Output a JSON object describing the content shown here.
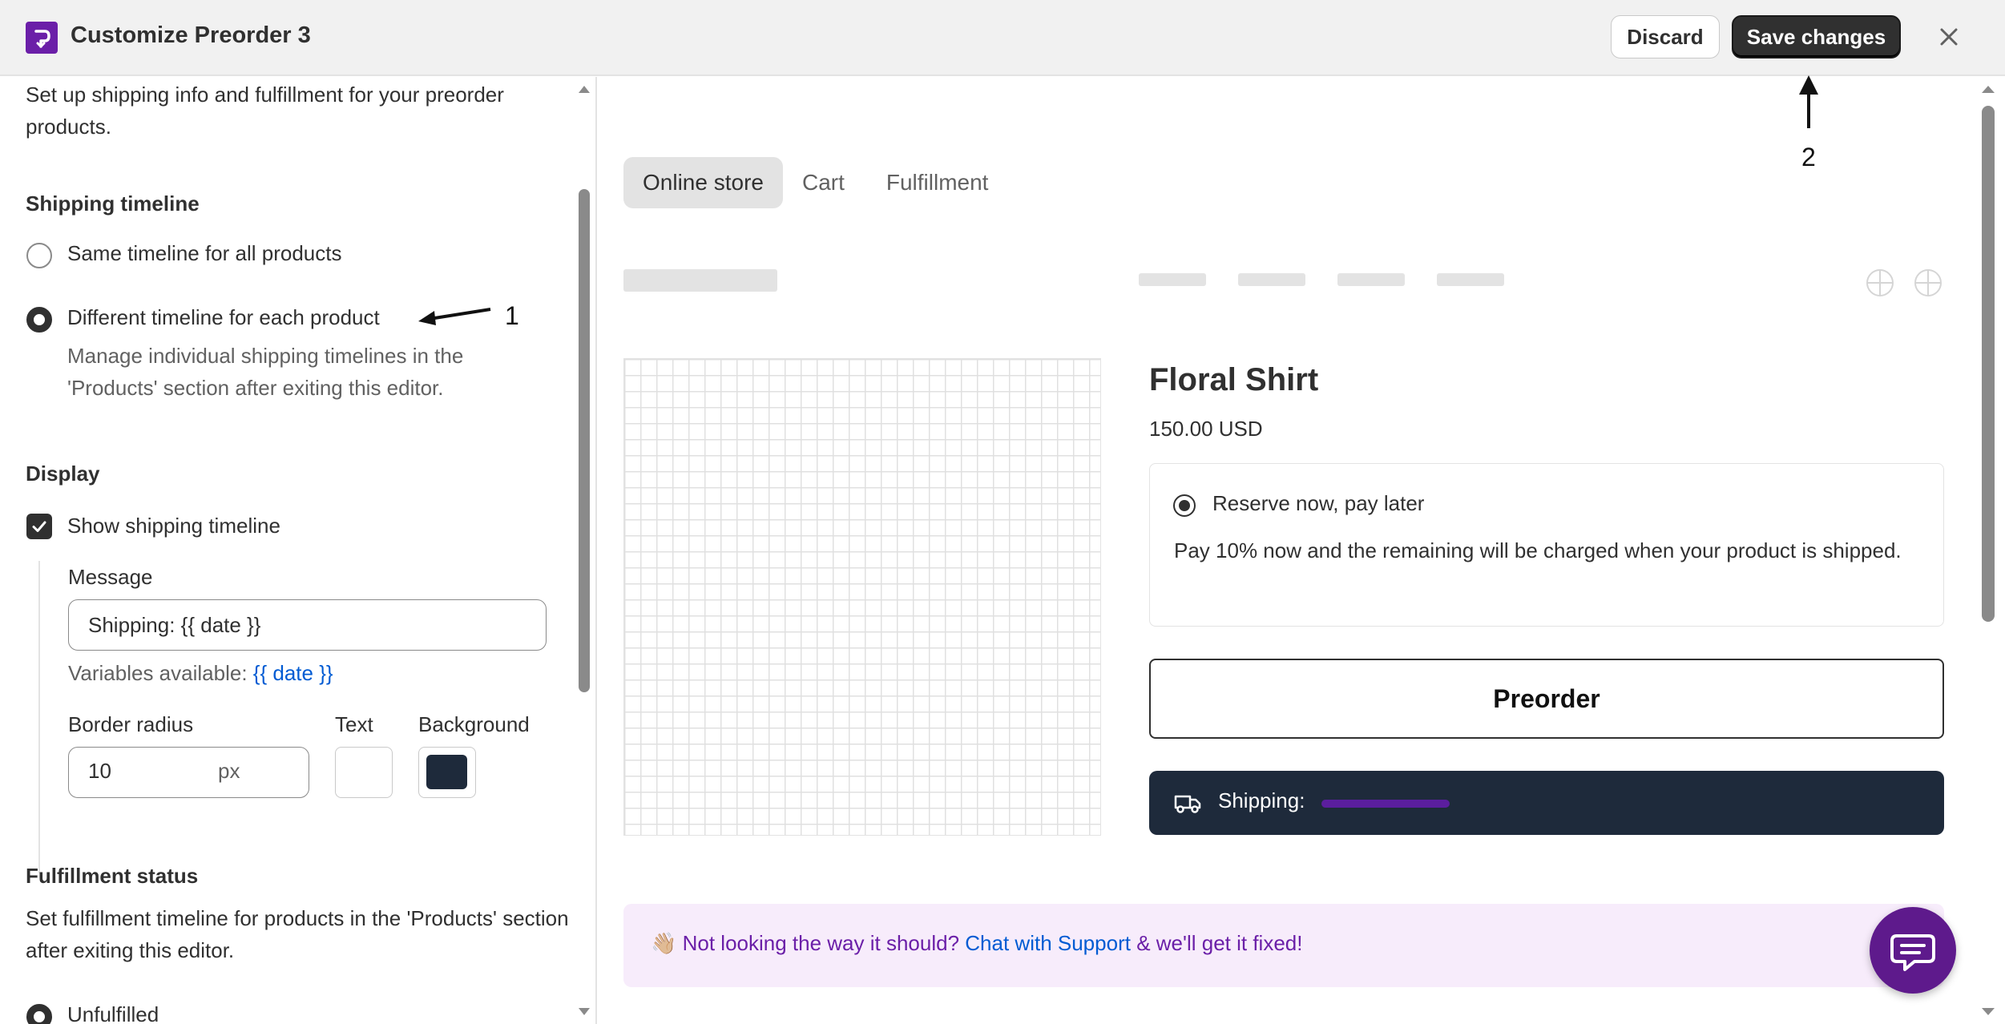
{
  "header": {
    "title": "Customize Preorder 3",
    "discard_label": "Discard",
    "save_label": "Save changes"
  },
  "left": {
    "intro": "Set up shipping info and fulfillment for your preorder products.",
    "shipping_timeline": {
      "heading": "Shipping timeline",
      "option_same": "Same timeline for all products",
      "option_different": "Different timeline for each product",
      "selected": "option_different",
      "help": "Manage individual shipping timelines in the 'Products' section after exiting this editor."
    },
    "display": {
      "heading": "Display",
      "show_label": "Show shipping timeline",
      "show_checked": true,
      "message_label": "Message",
      "message_value": "Shipping: {{ date }}",
      "variables_label": "Variables available:",
      "variables_value": "{{ date }}",
      "border_radius_label": "Border radius",
      "border_radius_value": "10",
      "border_radius_unit": "px",
      "text_label": "Text",
      "text_color": "#ffffff",
      "background_label": "Background",
      "background_color": "#1e2a3b"
    },
    "fulfillment": {
      "heading": "Fulfillment status",
      "help": "Set fulfillment timeline for products in the 'Products' section after exiting this editor.",
      "option_unfulfilled": "Unfulfilled"
    }
  },
  "preview": {
    "tabs": [
      {
        "label": "Online store",
        "active": true
      },
      {
        "label": "Cart",
        "active": false
      },
      {
        "label": "Fulfillment",
        "active": false
      }
    ],
    "product": {
      "title": "Floral Shirt",
      "price": "150.00 USD",
      "option_label": "Reserve now, pay later",
      "option_desc": "Pay 10% now and the remaining will be charged when your product is shipped.",
      "button_label": "Preorder",
      "shipping_label": "Shipping:"
    },
    "support": {
      "emoji": "👋🏼",
      "text_before": "Not looking the way it should?",
      "link": "Chat with Support",
      "text_after": "& we'll get it fixed!"
    }
  },
  "annotations": {
    "one": "1",
    "two": "2"
  },
  "colors": {
    "brand": "#6b1fa8",
    "primary_button": "#303030",
    "link": "#005bd3",
    "shipping_bar": "#1e2a3b"
  }
}
